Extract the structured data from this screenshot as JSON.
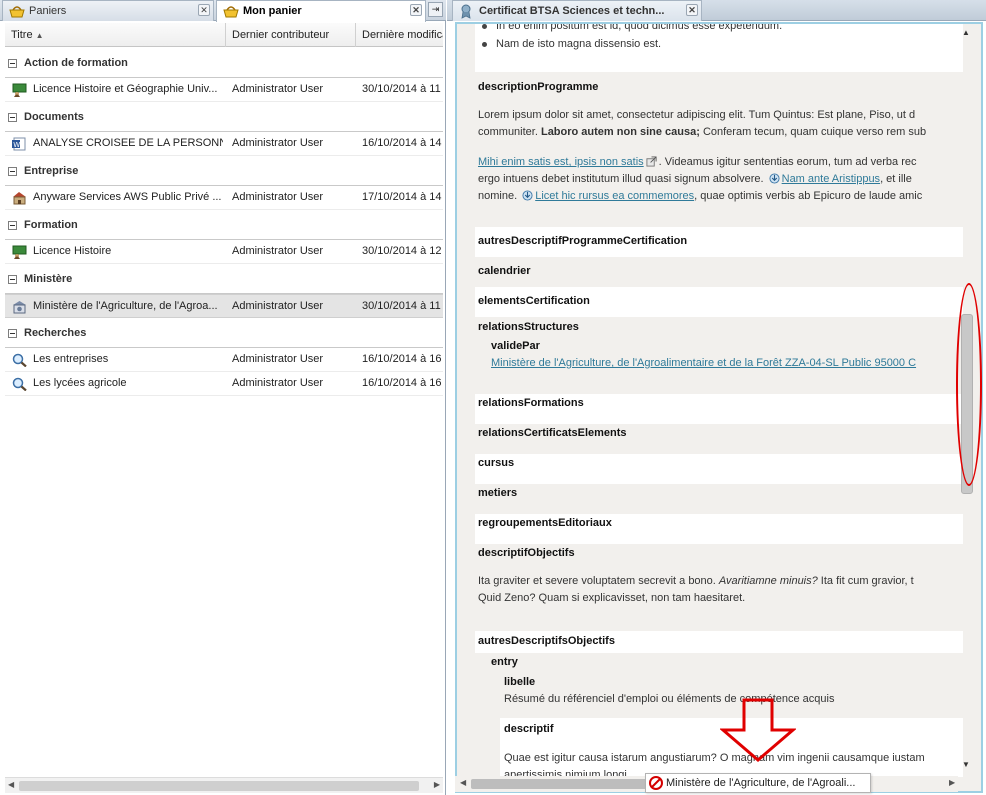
{
  "left": {
    "tabs": [
      {
        "label": "Paniers",
        "active": false
      },
      {
        "label": "Mon panier",
        "active": true
      }
    ],
    "columns": {
      "title": "Titre",
      "contributor": "Dernier contributeur",
      "date": "Dernière modifica"
    },
    "groups": [
      {
        "label": "Action de formation",
        "rows": [
          {
            "icon": "training-icon",
            "title": "Licence Histoire et Géographie Univ...",
            "contributor": "Administrator User",
            "date": "30/10/2014 à 11"
          }
        ]
      },
      {
        "label": "Documents",
        "rows": [
          {
            "icon": "word-document-icon",
            "title": "ANALYSE CROISEE DE LA PERSONN...",
            "contributor": "Administrator User",
            "date": "16/10/2014 à 14"
          }
        ]
      },
      {
        "label": "Entreprise",
        "rows": [
          {
            "icon": "company-icon",
            "title": "Anyware Services AWS Public Privé ...",
            "contributor": "Administrator User",
            "date": "17/10/2014 à 14"
          }
        ]
      },
      {
        "label": "Formation",
        "rows": [
          {
            "icon": "training-icon",
            "title": "Licence Histoire",
            "contributor": "Administrator User",
            "date": "30/10/2014 à 12"
          }
        ]
      },
      {
        "label": "Ministère",
        "rows": [
          {
            "icon": "ministry-icon",
            "title": "Ministère de l'Agriculture, de l'Agroa...",
            "contributor": "Administrator User",
            "date": "30/10/2014 à 11",
            "selected": true
          }
        ]
      },
      {
        "label": "Recherches",
        "rows": [
          {
            "icon": "search-icon",
            "title": "Les entreprises",
            "contributor": "Administrator User",
            "date": "16/10/2014 à 16"
          },
          {
            "icon": "search-icon",
            "title": "Les lycées agricole",
            "contributor": "Administrator User",
            "date": "16/10/2014 à 16"
          }
        ]
      }
    ]
  },
  "right": {
    "tab_label": "Certificat BTSA Sciences et techn...",
    "bullets": [
      "In eo enim positum est id, quod dicimus esse expetendum.",
      "Nam de isto magna dissensio est."
    ],
    "descriptionProgramme": {
      "heading": "descriptionProgramme",
      "line1": "Lorem ipsum dolor sit amet, consectetur adipiscing elit. Tum Quintus: Est plane, Piso, ut d",
      "line2_plain": "communiter. ",
      "line2_bold": "Laboro autem non sine causa;",
      "line2_rest": " Conferam tecum, quam cuique verso rem sub",
      "link1": "Mihi enim satis est, ipsis non satis",
      "line3_rest": ". Videamus igitur sententias eorum, tum ad verba rec",
      "line4_plain": "ergo intuens debet institutum illud quasi signum absolvere. ",
      "link2": "Nam ante Aristippus",
      "line4_rest": ", et ille",
      "line5_plain": "nomine. ",
      "link3": "Licet hic rursus ea commemores",
      "line5_rest": ", quae optimis verbis ab Epicuro de laude amic"
    },
    "fields": {
      "autres": "autresDescriptifProgrammeCertification",
      "calendrier": "calendrier",
      "elements": "elementsCertification",
      "relationsStructures": "relationsStructures",
      "validePar": "validePar",
      "valideParLink": "Ministère de l'Agriculture, de l'Agroalimentaire et de la Forêt ZZA-04-SL Public 95000 C",
      "relationsFormations": "relationsFormations",
      "relationsCertificatsElements": "relationsCertificatsElements",
      "cursus": "cursus",
      "metiers": "metiers",
      "regroupementsEditoriaux": "regroupementsEditoriaux",
      "descriptifObjectifs": "descriptifObjectifs",
      "objLine1_plain": "Ita graviter et severe voluptatem secrevit a bono. ",
      "objLine1_italic": "Avaritiamne minuis?",
      "objLine1_rest": " Ita fit cum gravior, t",
      "objLine2": "Quid Zeno? Quam si explicavisset, non tam haesitaret.",
      "autresDescriptifsObjectifs": "autresDescriptifsObjectifs",
      "entry": "entry",
      "libelle": "libelle",
      "libelleValue": "Résumé du référenciel d'emploi ou éléments de compétence acquis",
      "descriptif": "descriptif",
      "descLine1": "Quae est igitur causa istarum angustiarum? O magnam vim ingenii causamque iustam",
      "descLine2": "apertissimis nimium longi"
    },
    "tooltip": "Ministère de l'Agriculture, de l'Agroali..."
  },
  "colors": {
    "accent_link": "#2f7a99",
    "annotation_red": "#e00000",
    "frame_border": "#9dcfe3"
  }
}
